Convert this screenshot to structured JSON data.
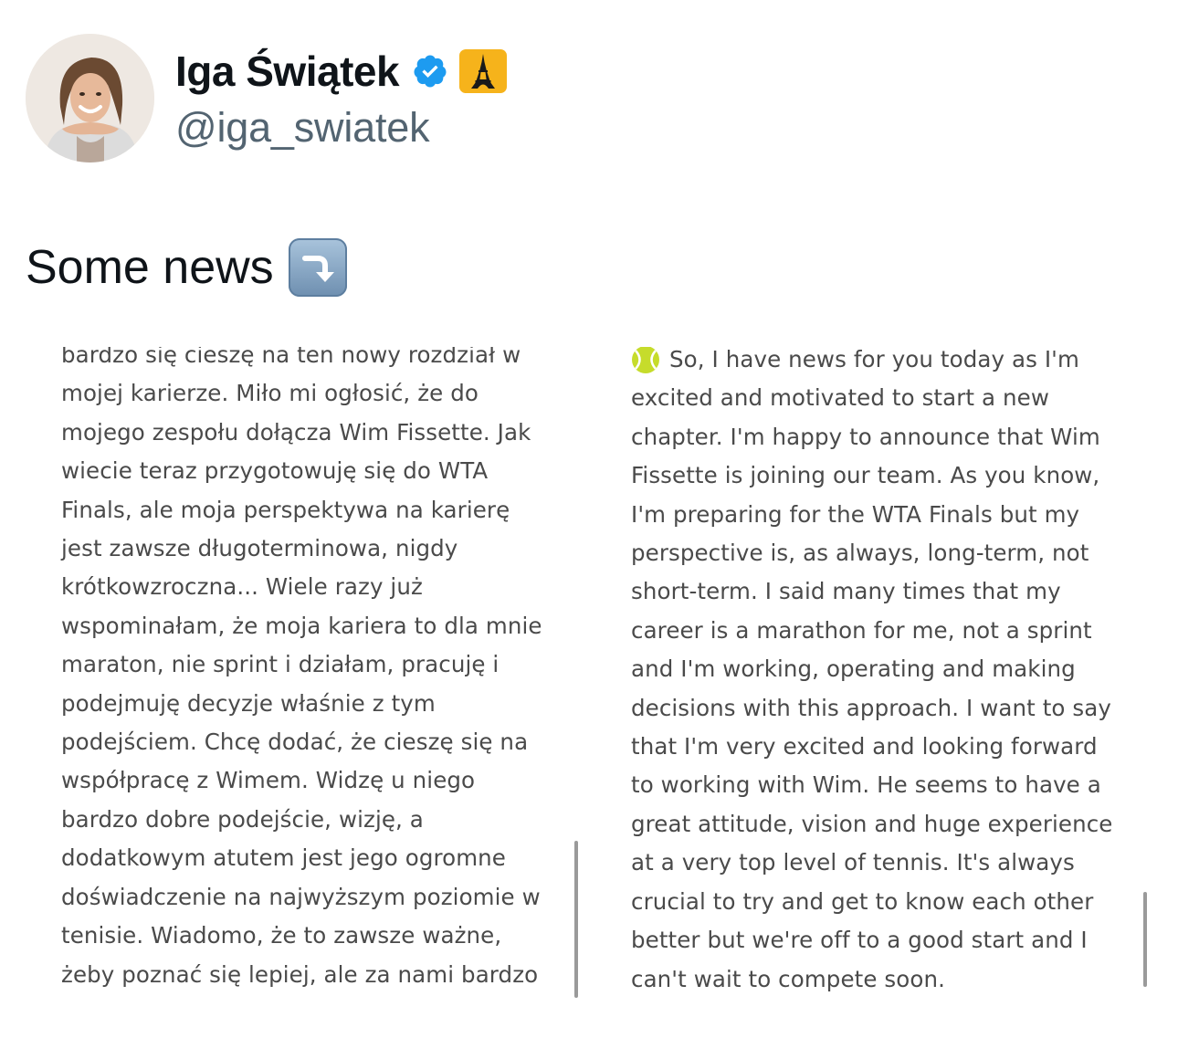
{
  "author": {
    "display_name": "Iga Świątek",
    "handle": "@iga_swiatek",
    "avatar": "avatar-photo",
    "verified_icon": "verified-badge-icon",
    "flair_icon": "eiffel-tower-icon"
  },
  "tweet": {
    "text": "Some news",
    "emoji": "arrow-curving-down-icon"
  },
  "media": {
    "left_panel": {
      "lines": [
        "bardzo się cieszę na ten nowy rozdział w",
        "mojej karierze. Miło mi ogłosić, że do",
        "mojego zespołu dołącza Wim Fissette. Jak",
        "wiecie teraz przygotowuję się do WTA",
        "Finals, ale moja perspektywa na karierę",
        "jest zawsze długoterminowa, nigdy",
        "krótkowzroczna... Wiele razy już",
        "wspominałam, że moja kariera to dla mnie",
        "maraton, nie sprint i działam, pracuję i",
        "podejmuję decyzje właśnie z tym",
        "podejściem. Chcę dodać, że cieszę się na",
        "współpracę z Wimem. Widzę u niego",
        "bardzo dobre podejście, wizję, a",
        "dodatkowym atutem jest jego ogromne",
        "doświadczenie na najwyższym poziomie w",
        "tenisie. Wiadomo, że to zawsze ważne,",
        "żeby poznać się lepiej, ale za nami bardzo"
      ]
    },
    "right_panel": {
      "icon": "tennis-ball-icon",
      "lines": [
        "So, I have news for you today as I'm",
        "excited and motivated to start a new",
        "chapter. I'm happy to announce that Wim",
        "Fissette is joining our team. As you know,",
        "I'm preparing for the WTA Finals but my",
        "perspective is, as always, long-term, not",
        "short-term. I said many times that my",
        "career is a marathon for me, not a sprint",
        "and I'm working, operating and making",
        "decisions with this approach. I want to say",
        "that I'm very excited and looking forward",
        "to working with Wim. He seems to have a",
        "great attitude, vision and huge experience",
        "at a very top level of tennis. It's always",
        "crucial to try and get to know each other",
        "better but we're off to a good start and I",
        "can't wait to compete soon."
      ]
    }
  },
  "colors": {
    "text_primary": "#0f1419",
    "text_secondary": "#536471",
    "verified_blue": "#1d9bf0",
    "badge_yellow": "#f6b31b",
    "panel_text": "#4a4a4a"
  }
}
